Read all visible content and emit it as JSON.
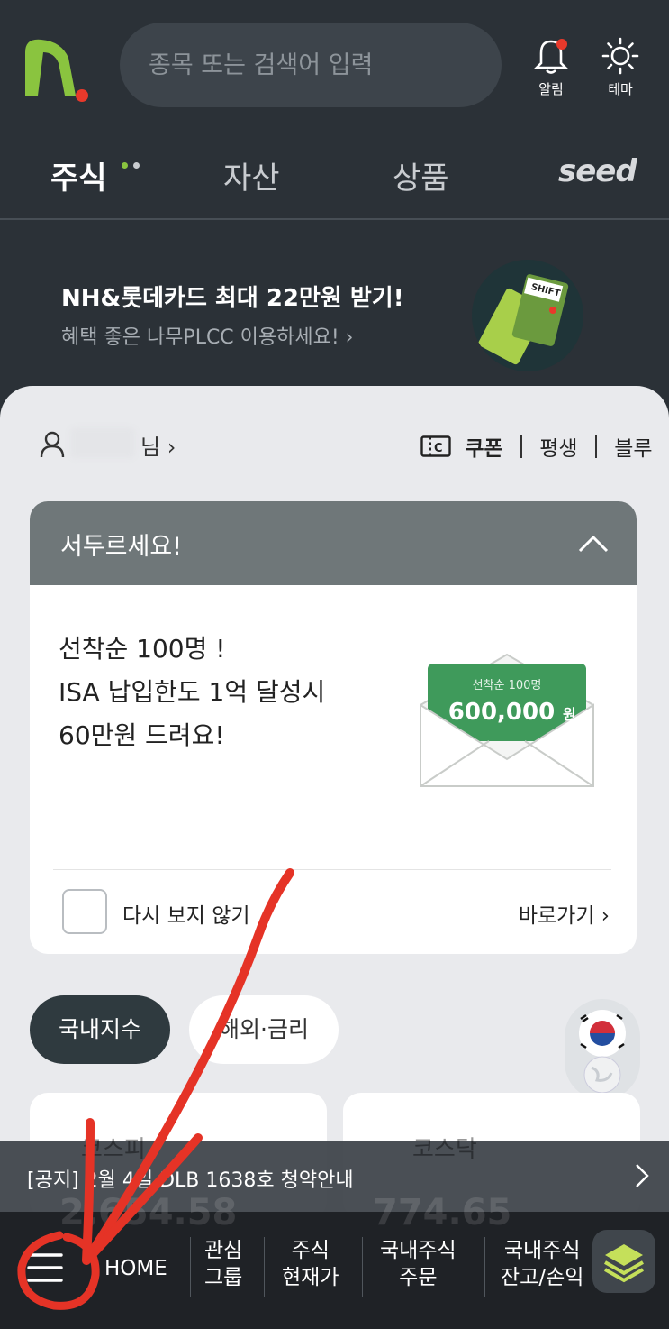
{
  "header": {
    "search_placeholder": "종목 또는 검색어 입력",
    "alarm_label": "알림",
    "theme_label": "테마"
  },
  "tabs": [
    {
      "label": "주식",
      "active": true
    },
    {
      "label": "자산",
      "active": false
    },
    {
      "label": "상품",
      "active": false
    },
    {
      "label": "seed",
      "active": false
    }
  ],
  "promo": {
    "title": "NH&롯데카드  최대 22만원 받기!",
    "subtitle": "혜택 좋은 나무PLCC 이용하세요!  ›"
  },
  "user": {
    "suffix": "님  ›",
    "coupon_label": "쿠폰",
    "tier_label": "평생",
    "grade_label": "블루"
  },
  "popup": {
    "title": "서두르세요!",
    "body": "선착순 100명 !\nISA 납입한도 1억 달성시\n60만원 드려요!",
    "envelope_caption": "선착순 100명",
    "envelope_amount": "600,000",
    "envelope_unit": "원",
    "dont_show_label": "다시 보지 않기",
    "goto_label": "바로가기  ›"
  },
  "market_tabs": [
    {
      "label": "국내지수",
      "active": true
    },
    {
      "label": "해외·금리",
      "active": false
    }
  ],
  "index_cards": [
    {
      "name": "코스피",
      "value": "2,654.58"
    },
    {
      "name": "코스닥",
      "value": "774.65"
    }
  ],
  "notice": {
    "text": "[공지] 2월 4일 DLB 1638호 청약안내"
  },
  "bottom_nav": [
    {
      "label": "HOME"
    },
    {
      "label": "관심\n그룹"
    },
    {
      "label": "주식\n현재가"
    },
    {
      "label": "국내주식\n주문"
    },
    {
      "label": "국내주식\n잔고/손익"
    }
  ],
  "colors": {
    "background": "#2b3137",
    "brand_green": "#8ac43f",
    "alert_red": "#e8392b",
    "popup_header": "#6f7779",
    "envelope_green": "#3f9a5b"
  }
}
